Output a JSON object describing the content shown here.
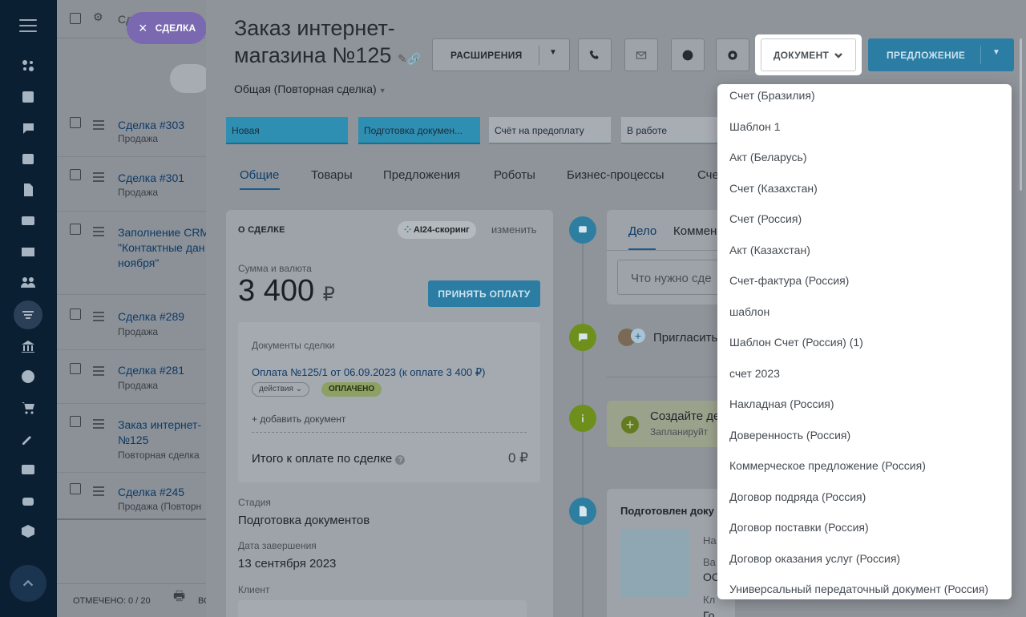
{
  "background_list": {
    "header_partial": "Сд",
    "close_pill": "СДЕЛКА",
    "rows": [
      {
        "title": "Сделка #303",
        "sub": "Продажа"
      },
      {
        "title": "Сделка #301",
        "sub": "Продажа"
      },
      {
        "title": "Заполнение CRM",
        "title2": "\"Контактные дан",
        "title3": "ноября\""
      },
      {
        "title": "Сделка #289",
        "sub": "Продажа"
      },
      {
        "title": "Сделка #281",
        "sub": "Продажа"
      },
      {
        "title": "Заказ интернет-",
        "title2": "№125",
        "sub": "Повторная сделка"
      },
      {
        "title": "Сделка #245",
        "sub": "Продажа (Повторн"
      }
    ],
    "footer": "ОТМЕЧЕНО: 0 / 20",
    "footer2": "ВС"
  },
  "deal": {
    "title_line1": "Заказ интернет-",
    "title_line2": "магазина №125",
    "pipeline": "Общая (Повторная сделка)"
  },
  "toolbar": {
    "extensions": "РАСШИРЕНИЯ",
    "document": "ДОКУМЕНТ",
    "offer": "ПРЕДЛОЖЕНИЕ"
  },
  "stages": [
    "Новая",
    "Подготовка докумен...",
    "Счёт на предоплату",
    "В работе"
  ],
  "tabs": [
    "Общие",
    "Товары",
    "Предложения",
    "Роботы",
    "Бизнес-процессы",
    "Сче"
  ],
  "about": {
    "header": "О СДЕЛКЕ",
    "score": "AI24-скоринг",
    "edit": "изменить",
    "sum_label": "Сумма и валюта",
    "sum_value": "3 400",
    "currency": "₽",
    "pay_button": "ПРИНЯТЬ ОПЛАТУ",
    "docs_header": "Документы сделки",
    "doc_link": "Оплата №125/1 от 06.09.2023 (к оплате 3 400 ₽)",
    "actions": "действия",
    "paid_badge": "ОПЛАЧЕНО",
    "add_doc": "+ добавить документ",
    "total_label": "Итого к оплате по сделке",
    "total_value": "0 ₽",
    "stage_label": "Стадия",
    "stage_value": "Подготовка документов",
    "close_label": "Дата завершения",
    "close_value": "13 сентября 2023",
    "client_label": "Клиент"
  },
  "timeline": {
    "tab_deal": "Дело",
    "tab_comment": "Коммен",
    "input_placeholder": "Что нужно сде",
    "invite": "Пригласить",
    "create": "Создайте де",
    "plan": "Запланируйт",
    "prepared": "Подготовлен доку",
    "na": "На",
    "va": "Ва",
    "oc": "ОС",
    "kl": "Кл",
    "go": "Го"
  },
  "document_menu": [
    "Счет (Бразилия)",
    "Шаблон 1",
    "Акт (Беларусь)",
    "Счет (Казахстан)",
    "Счет (Россия)",
    "Акт (Казахстан)",
    "Счет-фактура (Россия)",
    "шаблон",
    "Шаблон Счет (Россия) (1)",
    "счет 2023",
    "Накладная (Россия)",
    "Доверенность (Россия)",
    "Коммерческое предложение (Россия)",
    "Договор подряда (Россия)",
    "Договор поставки (Россия)",
    "Договор оказания услуг (Россия)",
    "Универсальный передаточный документ (Россия)"
  ]
}
